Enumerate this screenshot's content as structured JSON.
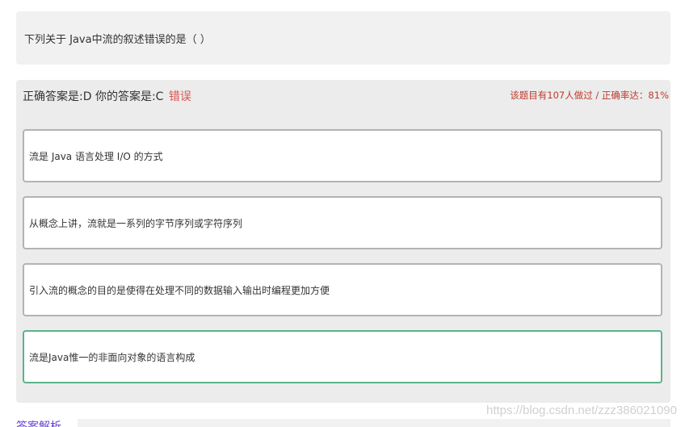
{
  "question": {
    "text": "下列关于 Java中流的叙述错误的是（   ）"
  },
  "result": {
    "correct_label": "正确答案是:D",
    "your_label": "你的答案是:C",
    "verdict": "错误",
    "stats": "该题目有107人做过 / 正确率达：81%"
  },
  "options": [
    {
      "text": "流是 Java 语言处理 I/O 的方式"
    },
    {
      "text": "从概念上讲，流就是一系列的字节序列或字符序列"
    },
    {
      "text": "引入流的概念的目的是使得在处理不同的数据输入输出时编程更加方便"
    },
    {
      "text": "流是Java惟一的非面向对象的语言构成"
    }
  ],
  "footer": {
    "analysis_link": "答案解析"
  },
  "watermark": "https://blog.csdn.net/zzz386021090",
  "colors": {
    "wrong": "#d9534f",
    "correct_border": "#5cb38a",
    "link": "#6a3fd6"
  }
}
